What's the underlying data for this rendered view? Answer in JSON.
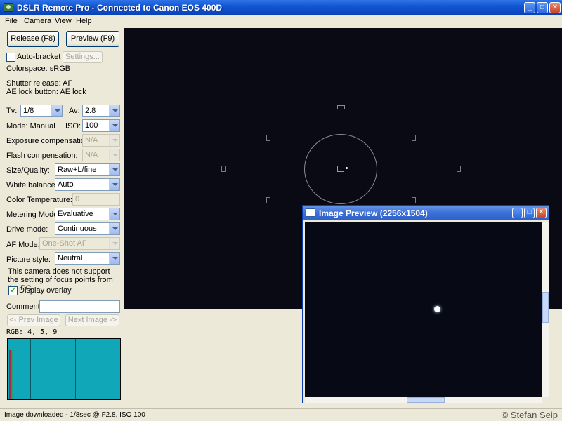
{
  "window": {
    "title": "DSLR Remote Pro - Connected to Canon EOS 400D"
  },
  "menu": [
    "File",
    "Camera",
    "View",
    "Help"
  ],
  "panel": {
    "release_label": "Release (F8)",
    "preview_label": "Preview (F9)",
    "autobracket_label": "Auto-bracket",
    "settings_label": "Settings...",
    "colorspace": "Colorspace: sRGB",
    "shutter_release": "Shutter release: AF",
    "ae_lock": "AE lock button: AE lock",
    "tv_label": "Tv:",
    "tv_value": "1/8",
    "av_label": "Av:",
    "av_value": "2.8",
    "mode": "Mode: Manual",
    "iso_label": "ISO:",
    "iso_value": "100",
    "exposure_comp_label": "Exposure compensation:",
    "exposure_comp_value": "N/A",
    "flash_comp_label": "Flash compensation:",
    "flash_comp_value": "N/A",
    "size_quality_label": "Size/Quality:",
    "size_quality_value": "Raw+L/fine",
    "white_balance_label": "White balance:",
    "white_balance_value": "Auto",
    "color_temp_label": "Color Temperature:",
    "color_temp_value": "0",
    "metering_label": "Metering Mode:",
    "metering_value": "Evaluative",
    "drive_label": "Drive mode:",
    "drive_value": "Continuous",
    "af_label": "AF Mode:",
    "af_value": "One-Shot AF",
    "picture_style_label": "Picture style:",
    "picture_style_value": "Neutral",
    "focus_note": "This camera does not support the setting of focus points from the PC",
    "display_overlay_label": "Display overlay",
    "comment_label": "Comment:",
    "comment_value": "",
    "prev_image_label": "<- Prev Image",
    "next_image_label": "Next Image ->",
    "rgb_label": "RGB:  4, 5, 9"
  },
  "preview_window": {
    "title": "Image Preview (2256x1504)"
  },
  "status": {
    "text": "Image downloaded - 1/8sec @ F2.8, ISO 100",
    "copyright": "© Stefan Seip"
  }
}
